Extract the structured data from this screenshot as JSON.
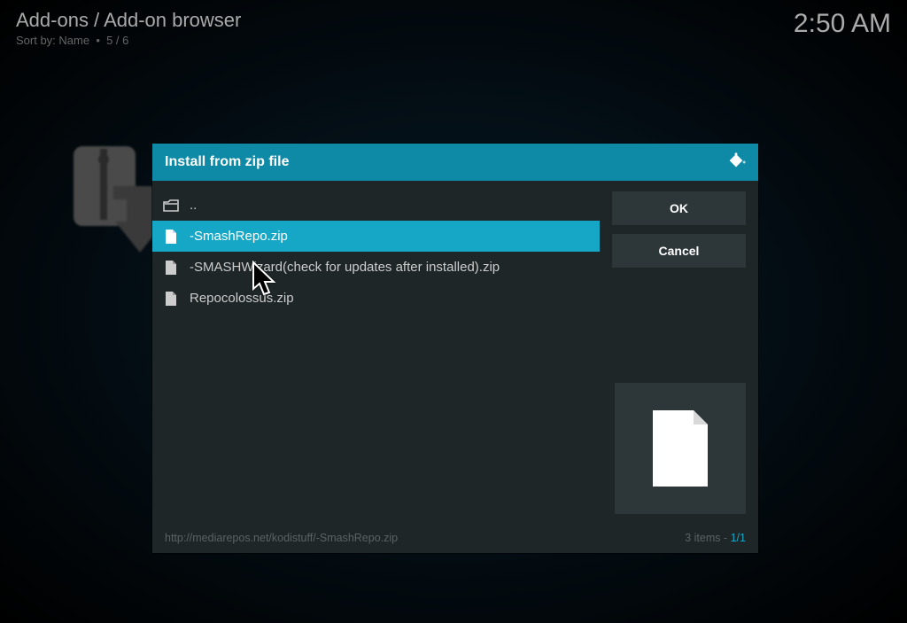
{
  "header": {
    "breadcrumb": "Add-ons / Add-on browser",
    "sort_label": "Sort by: Name",
    "position": "5 / 6",
    "clock": "2:50 AM"
  },
  "dialog": {
    "title": "Install from zip file",
    "ok_label": "OK",
    "cancel_label": "Cancel",
    "path": "http://mediarepos.net/kodistuff/-SmashRepo.zip",
    "count_text": "3 items - ",
    "page": "1/1",
    "files": {
      "parent": "..",
      "f0": "-SmashRepo.zip",
      "f1": "-SMASHWizard(check for updates after installed).zip",
      "f2": "Repocolossus.zip"
    }
  }
}
